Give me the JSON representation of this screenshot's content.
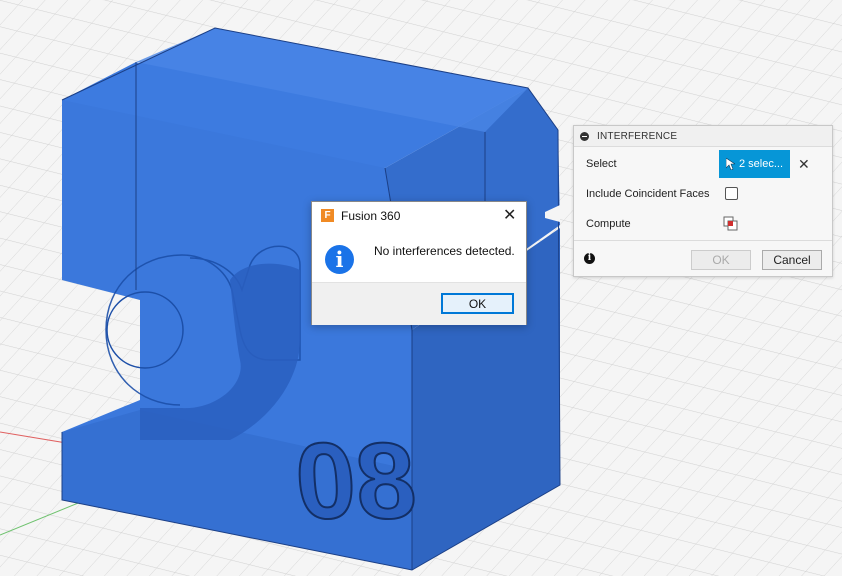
{
  "viewport": {
    "model_digits": "08",
    "grid_color": "#c8c8c8",
    "model_color": "#3a78d6"
  },
  "interference_panel": {
    "title": "INTERFERENCE",
    "select_label": "Select",
    "select_button": "2 selec...",
    "coincident_label": "Include Coincident Faces",
    "coincident_checked": false,
    "compute_label": "Compute",
    "ok_label": "OK",
    "cancel_label": "Cancel",
    "accent_color": "#0696d7"
  },
  "dialog": {
    "title": "Fusion 360",
    "logo_letter": "F",
    "message": "No interferences detected.",
    "ok_label": "OK",
    "close_glyph": "✕",
    "info_glyph": "i"
  }
}
